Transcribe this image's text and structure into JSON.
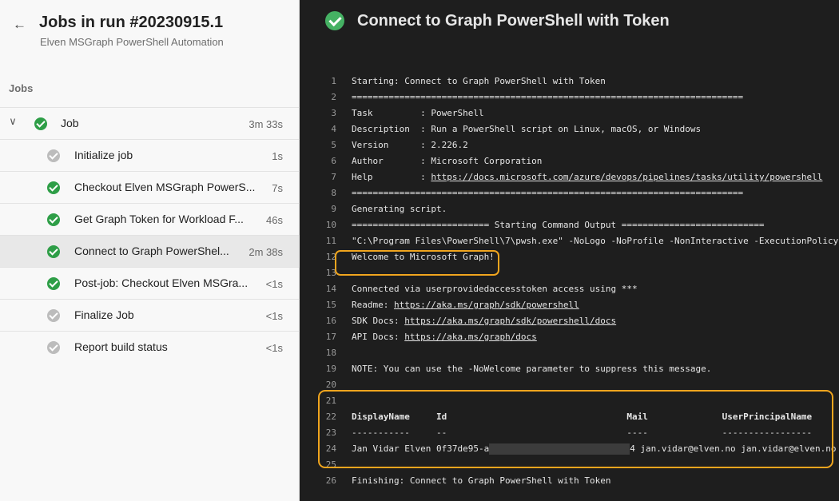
{
  "header": {
    "title": "Jobs in run #20230915.1",
    "subtitle": "Elven MSGraph PowerShell Automation",
    "back_icon": "←"
  },
  "jobs_section": {
    "label": "Jobs"
  },
  "job": {
    "label": "Job",
    "duration": "3m 33s",
    "chevron": "∨",
    "status": "succeeded"
  },
  "steps": [
    {
      "label": "Initialize job",
      "duration": "1s",
      "status": "skipped"
    },
    {
      "label": "Checkout Elven MSGraph PowerS...",
      "duration": "7s",
      "status": "succeeded"
    },
    {
      "label": "Get Graph Token for Workload F...",
      "duration": "46s",
      "status": "succeeded"
    },
    {
      "label": "Connect to Graph PowerShel...",
      "duration": "2m 38s",
      "status": "succeeded",
      "selected": true
    },
    {
      "label": "Post-job: Checkout Elven MSGra...",
      "duration": "<1s",
      "status": "succeeded"
    },
    {
      "label": "Finalize Job",
      "duration": "<1s",
      "status": "skipped"
    },
    {
      "label": "Report build status",
      "duration": "<1s",
      "status": "skipped"
    }
  ],
  "log_panel": {
    "title": "Connect to Graph PowerShell with Token",
    "status": "succeeded",
    "lines": [
      {
        "no": "1",
        "text": "Starting: Connect to Graph PowerShell with Token"
      },
      {
        "no": "2",
        "text": "=========================================================================="
      },
      {
        "no": "3",
        "text": "Task         : PowerShell"
      },
      {
        "no": "4",
        "text": "Description  : Run a PowerShell script on Linux, macOS, or Windows"
      },
      {
        "no": "5",
        "text": "Version      : 2.226.2"
      },
      {
        "no": "6",
        "text": "Author       : Microsoft Corporation"
      },
      {
        "no": "7",
        "text": "Help         : ",
        "link": "https://docs.microsoft.com/azure/devops/pipelines/tasks/utility/powershell"
      },
      {
        "no": "8",
        "text": "=========================================================================="
      },
      {
        "no": "9",
        "text": "Generating script."
      },
      {
        "no": "10",
        "text": "========================== Starting Command Output ==========================="
      },
      {
        "no": "11",
        "text": "\"C:\\Program Files\\PowerShell\\7\\pwsh.exe\" -NoLogo -NoProfile -NonInteractive -ExecutionPolicy"
      },
      {
        "no": "12",
        "text": "Welcome to Microsoft Graph!"
      },
      {
        "no": "13",
        "text": ""
      },
      {
        "no": "14",
        "text": "Connected via userprovidedaccesstoken access using ***"
      },
      {
        "no": "15",
        "text": "Readme: ",
        "link": "https://aka.ms/graph/sdk/powershell"
      },
      {
        "no": "16",
        "text": "SDK Docs: ",
        "link": "https://aka.ms/graph/sdk/powershell/docs"
      },
      {
        "no": "17",
        "text": "API Docs: ",
        "link": "https://aka.ms/graph/docs"
      },
      {
        "no": "18",
        "text": ""
      },
      {
        "no": "19",
        "text": "NOTE: You can use the -NoWelcome parameter to suppress this message."
      },
      {
        "no": "20",
        "text": ""
      },
      {
        "no": "21",
        "text": ""
      },
      {
        "no": "22",
        "text": "DisplayName     Id                                  Mail              UserPrincipalName"
      },
      {
        "no": "23",
        "text": "-----------     --                                  ----              -----------------"
      },
      {
        "no": "24",
        "text_before": "Jan Vidar Elven 0f37de95-a",
        "text_after": "4 jan.vidar@elven.no jan.vidar@elven.no"
      },
      {
        "no": "25",
        "text": ""
      },
      {
        "no": "26",
        "text": "Finishing: Connect to Graph PowerShell with Token"
      }
    ]
  },
  "colors": {
    "success": "#2e9e47",
    "skipped": "#bcbcbc",
    "log_green": "#6ed67e",
    "log_blue": "#62b0f5",
    "highlight": "#f0a51e"
  }
}
